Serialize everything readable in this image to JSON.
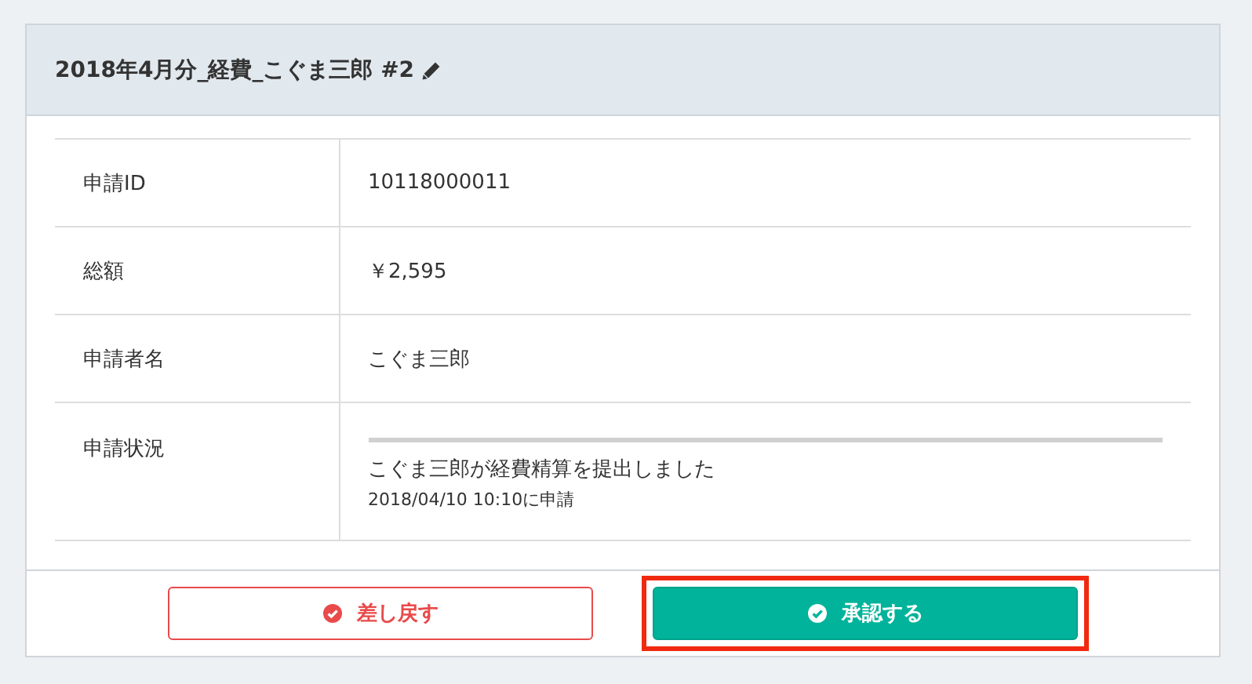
{
  "title": "2018年4月分_経費_こぐま三郎 #2",
  "rows": [
    {
      "label": "申請ID",
      "value": "10118000011"
    },
    {
      "label": "総額",
      "value": "￥2,595"
    },
    {
      "label": "申請者名",
      "value": "こぐま三郎"
    },
    {
      "label": "申請状況",
      "kind": "status",
      "message": "こぐま三郎が経費精算を提出しました",
      "timestamp": "2018/04/10 10:10に申請"
    }
  ],
  "buttons": [
    {
      "label": "差し戻す",
      "kind": "reject",
      "highlighted": false
    },
    {
      "label": "承認する",
      "kind": "approve",
      "highlighted": true
    }
  ]
}
